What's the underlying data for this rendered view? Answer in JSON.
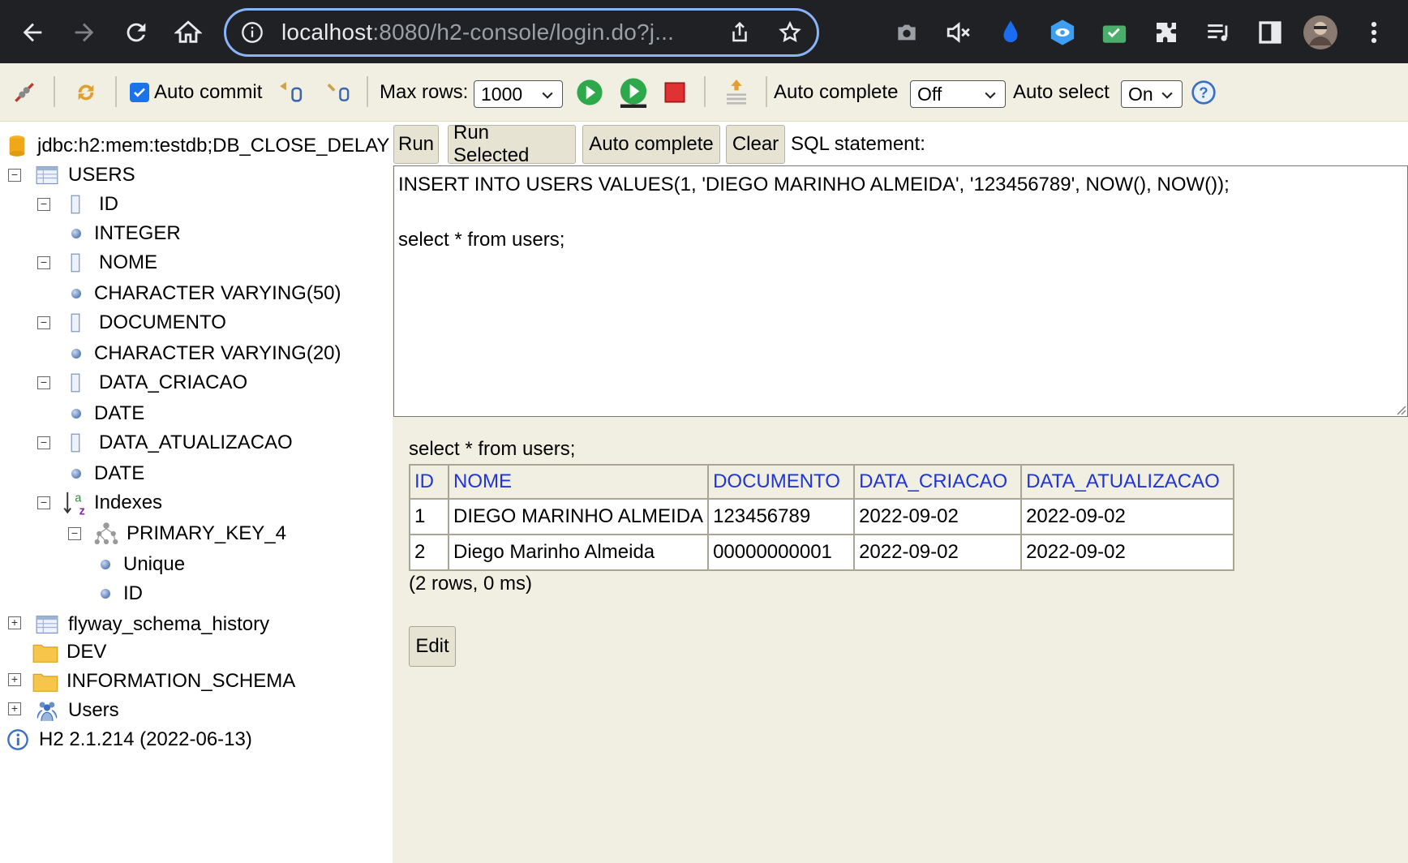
{
  "browser": {
    "url_host": "localhost",
    "url_rest": ":8080/h2-console/login.do?j..."
  },
  "toolbar": {
    "auto_commit_label": "Auto commit",
    "auto_commit_checked": true,
    "max_rows_label": "Max rows:",
    "max_rows_value": "1000",
    "auto_complete_label": "Auto complete",
    "auto_complete_value": "Off",
    "auto_select_label": "Auto select",
    "auto_select_value": "On"
  },
  "tree": {
    "connection": "jdbc:h2:mem:testdb;DB_CLOSE_DELAY",
    "table_name": "USERS",
    "columns": [
      {
        "name": "ID",
        "type": "INTEGER"
      },
      {
        "name": "NOME",
        "type": "CHARACTER VARYING(50)"
      },
      {
        "name": "DOCUMENTO",
        "type": "CHARACTER VARYING(20)"
      },
      {
        "name": "DATA_CRIACAO",
        "type": "DATE"
      },
      {
        "name": "DATA_ATUALIZACAO",
        "type": "DATE"
      }
    ],
    "indexes_label": "Indexes",
    "index_name": "PRIMARY_KEY_4",
    "index_props": [
      "Unique",
      "ID"
    ],
    "other_items": [
      "flyway_schema_history",
      "DEV",
      "INFORMATION_SCHEMA",
      "Users"
    ],
    "version": "H2 2.1.214 (2022-06-13)"
  },
  "query_bar": {
    "run": "Run",
    "run_selected": "Run Selected",
    "auto_complete": "Auto complete",
    "clear": "Clear",
    "sql_statement_label": "SQL statement:"
  },
  "sql_text": "INSERT INTO USERS VALUES(1, 'DIEGO MARINHO ALMEIDA', '123456789', NOW(), NOW());\n\nselect * from users;",
  "result": {
    "query": "select * from users;",
    "headers": [
      "ID",
      "NOME",
      "DOCUMENTO",
      "DATA_CRIACAO",
      "DATA_ATUALIZACAO"
    ],
    "rows": [
      [
        "1",
        "DIEGO MARINHO ALMEIDA",
        "123456789",
        "2022-09-02",
        "2022-09-02"
      ],
      [
        "2",
        "Diego Marinho Almeida",
        "00000000001",
        "2022-09-02",
        "2022-09-02"
      ]
    ],
    "meta": "(2 rows, 0 ms)",
    "edit_label": "Edit"
  }
}
